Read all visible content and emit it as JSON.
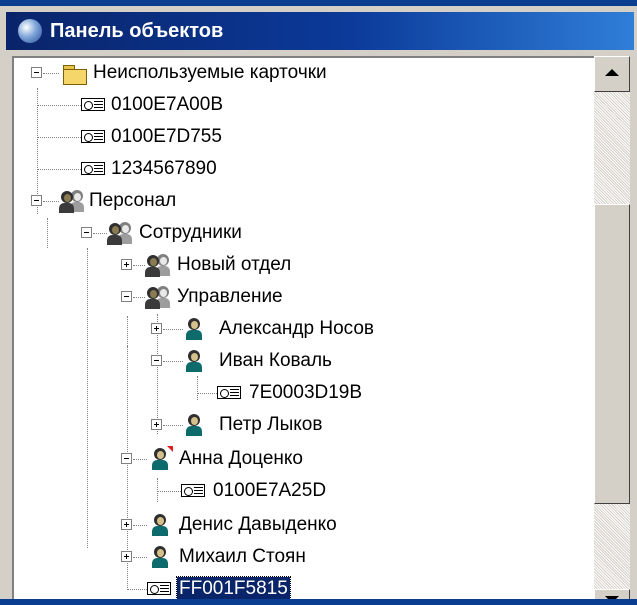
{
  "window": {
    "title": "Панель объектов",
    "title_icon": "globe-icon"
  },
  "tree": {
    "nodes": [
      {
        "label": "Неиспользуемые карточки",
        "icon": "folder-icon",
        "toggle": "minus"
      },
      {
        "label": "0100E7A00B",
        "icon": "card-icon"
      },
      {
        "label": "0100E7D755",
        "icon": "card-icon"
      },
      {
        "label": "1234567890",
        "icon": "card-icon"
      },
      {
        "label": "Персонал",
        "icon": "group-icon",
        "toggle": "minus"
      },
      {
        "label": "Сотрудники",
        "icon": "group-icon",
        "toggle": "minus"
      },
      {
        "label": "Новый отдел",
        "icon": "group-icon",
        "toggle": "plus"
      },
      {
        "label": "Управление",
        "icon": "group-icon",
        "toggle": "minus"
      },
      {
        "label": "Александр Носов",
        "icon": "person-icon",
        "toggle": "plus"
      },
      {
        "label": "Иван Коваль",
        "icon": "person-icon",
        "toggle": "minus"
      },
      {
        "label": "7E0003D19B",
        "icon": "card-icon"
      },
      {
        "label": "Петр Лыков",
        "icon": "person-icon",
        "toggle": "plus"
      },
      {
        "label": "Анна Доценко",
        "icon": "person-flag-icon",
        "toggle": "minus"
      },
      {
        "label": "0100E7A25D",
        "icon": "card-icon"
      },
      {
        "label": "Денис Давыденко",
        "icon": "person-icon",
        "toggle": "plus"
      },
      {
        "label": "Михаил Стоян",
        "icon": "person-icon",
        "toggle": "plus"
      },
      {
        "label": "FF001F5815",
        "icon": "card-icon",
        "selected": true
      }
    ]
  },
  "colors": {
    "titlebar_start": "#0a246a",
    "titlebar_end": "#2f7ed8",
    "selection": "#0a246a"
  }
}
